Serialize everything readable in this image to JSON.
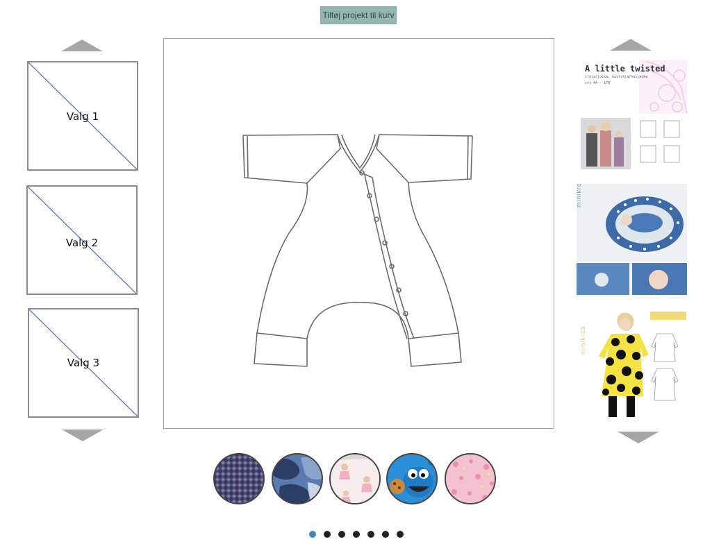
{
  "toolbar": {
    "add_to_cart": "Tilføj projekt til kurv"
  },
  "options": [
    {
      "label": "Valg 1"
    },
    {
      "label": "Valg 2"
    },
    {
      "label": "Valg 3"
    }
  ],
  "patterns": [
    {
      "title": "A little twisted",
      "subtitle": "tröja/jacka, huvtröja/huvjacka",
      "size": "stl 44 - 170"
    },
    {
      "brand": "minikrea"
    },
    {
      "brand": "minikrea"
    }
  ],
  "swatches": [
    {
      "name": "multicolor-knit-swatch",
      "color": "#4a4a6a"
    },
    {
      "name": "blue-camo-swatch",
      "color": "#3d5a8a"
    },
    {
      "name": "princess-print-swatch",
      "color": "#f3e4e4"
    },
    {
      "name": "cookie-monster-swatch",
      "color": "#2a8fd6"
    },
    {
      "name": "pink-floral-swatch",
      "color": "#f2b4c4"
    }
  ],
  "pagination": {
    "count": 7,
    "active": 0
  },
  "colors": {
    "accent": "#93b7b0",
    "active_dot": "#3a88c5"
  }
}
